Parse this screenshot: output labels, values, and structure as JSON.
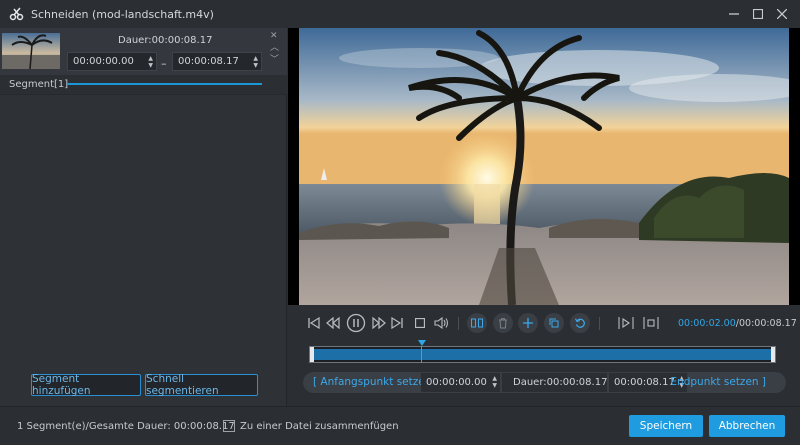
{
  "window": {
    "title": "Schneiden (mod-landschaft.m4v)",
    "logo_icon": "scissors-logo-icon"
  },
  "segment": {
    "duration_label": "Dauer:00:00:08.17",
    "start_time": "00:00:00.00",
    "end_time": "00:00:08.17",
    "label": "Segment[1]"
  },
  "left_buttons": {
    "add_segment": "Segment hinzufügen",
    "quick_split": "Schnell segmentieren"
  },
  "playback": {
    "current_time": "00:00:02.00",
    "total_time": "/00:00:08.17"
  },
  "timeline": {
    "playhead_position": 0.24
  },
  "trim": {
    "set_start": "[ Anfangspunkt setzen",
    "start_time": "00:00:00.00",
    "duration": "Dauer:00:00:08.17",
    "end_time": "00:00:08.17",
    "set_end": "Endpunkt setzen ]"
  },
  "footer": {
    "info": "1 Segment(e)/Gesamte Dauer: 00:00:08.17",
    "merge_label": "Zu einer Datei zusammenfügen",
    "merge_checked": false,
    "save": "Speichern",
    "cancel": "Abbrechen"
  },
  "colors": {
    "accent": "#1f9be0",
    "background": "#2b2e33"
  }
}
